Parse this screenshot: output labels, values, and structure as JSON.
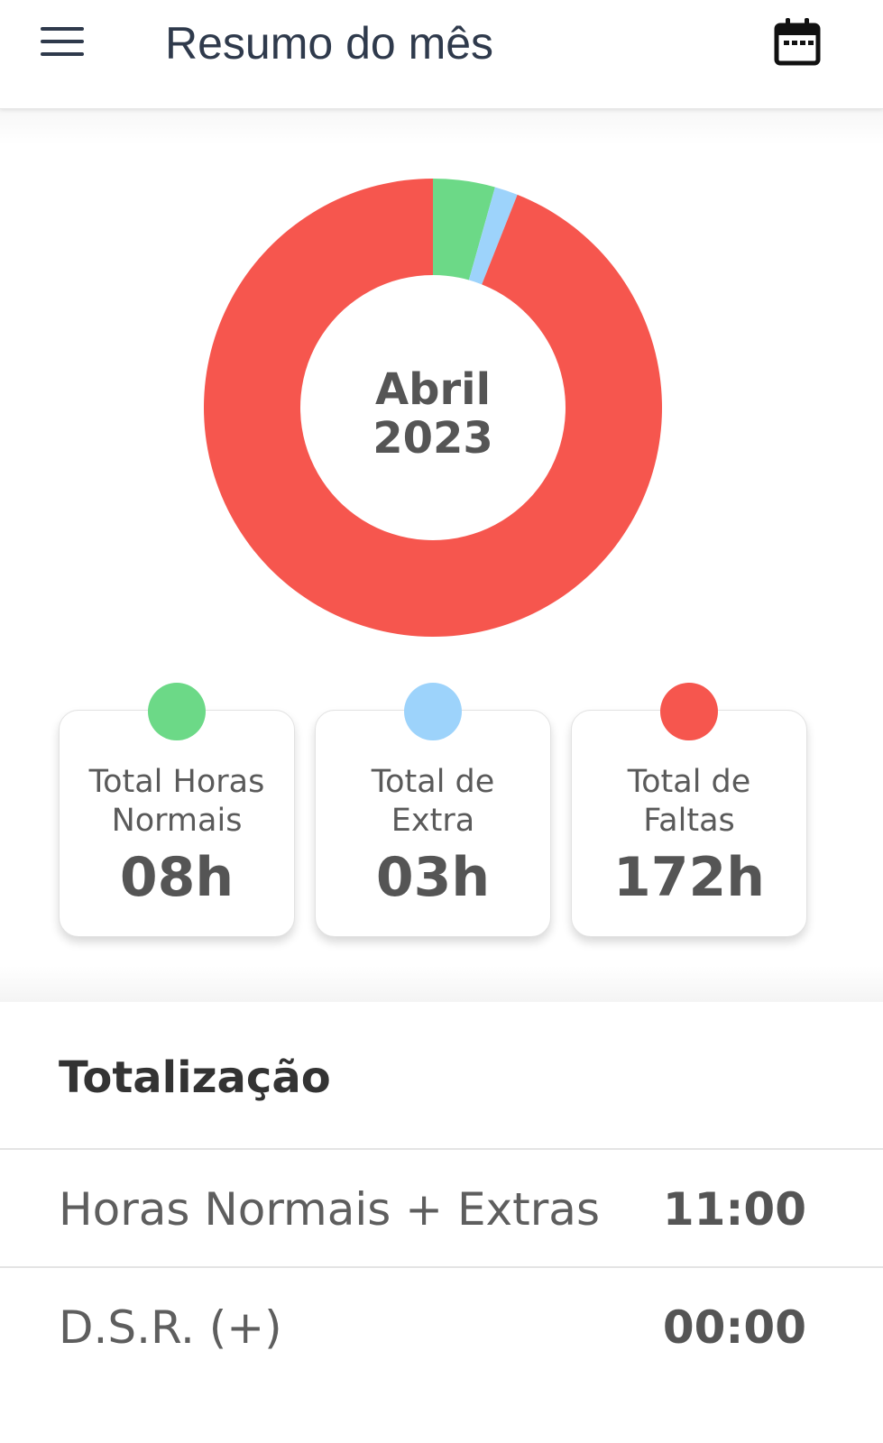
{
  "header": {
    "title": "Resumo do mês",
    "menu_icon": "hamburger-menu-icon",
    "calendar_icon": "calendar-icon"
  },
  "chart_data": {
    "type": "pie",
    "center_label": [
      "Abril",
      "2023"
    ],
    "series": [
      {
        "name": "Total Horas Normais",
        "value": 8,
        "color": "#6cd987"
      },
      {
        "name": "Total de Extra",
        "value": 3,
        "color": "#9dd3fb"
      },
      {
        "name": "Total de Faltas",
        "value": 172,
        "color": "#f6564e"
      }
    ]
  },
  "cards": [
    {
      "label_line1": "Total Horas",
      "label_line2": "Normais",
      "value": "08h",
      "color": "#6cd987"
    },
    {
      "label_line1": "Total de",
      "label_line2": "Extra",
      "value": "03h",
      "color": "#9dd3fb"
    },
    {
      "label_line1": "Total de",
      "label_line2": "Faltas",
      "value": "172h",
      "color": "#f6564e"
    }
  ],
  "totals": {
    "title": "Totalização",
    "rows": [
      {
        "label": "Horas Normais + Extras",
        "value": "11:00"
      },
      {
        "label": "D.S.R. (+)",
        "value": "00:00"
      }
    ]
  }
}
